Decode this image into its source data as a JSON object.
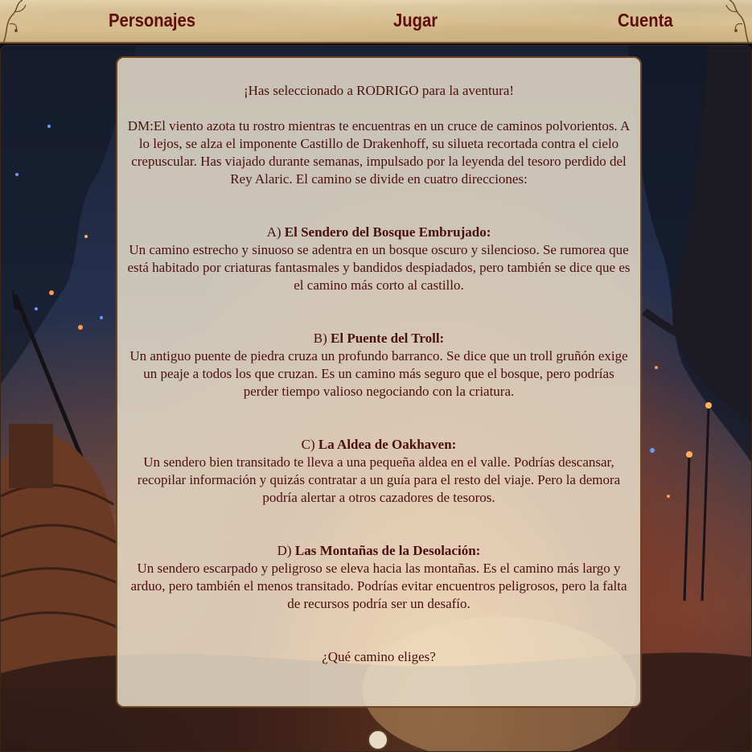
{
  "nav": {
    "items": [
      {
        "label": "Personajes"
      },
      {
        "label": "Jugar"
      },
      {
        "label": "Cuenta"
      }
    ]
  },
  "story": {
    "selected": "¡Has seleccionado a RODRIGO para la aventura!",
    "intro": "DM:El viento azota tu rostro mientras te encuentras en un cruce de caminos polvorientos. A lo lejos, se alza el imponente Castillo de Drakenhoff, su silueta recortada contra el cielo crepuscular. Has viajado durante semanas, impulsado por la leyenda del tesoro perdido del Rey Alaric. El camino se divide en cuatro direcciones:",
    "options": [
      {
        "letter": "A)",
        "title": "El Sendero del Bosque Embrujado:",
        "description": "Un camino estrecho y sinuoso se adentra en un bosque oscuro y silencioso. Se rumorea que está habitado por criaturas fantasmales y bandidos despiadados, pero también se dice que es el camino más corto al castillo."
      },
      {
        "letter": "B)",
        "title": "El Puente del Troll:",
        "description": "Un antiguo puente de piedra cruza un profundo barranco. Se dice que un troll gruñón exige un peaje a todos los que cruzan. Es un camino más seguro que el bosque, pero podrías perder tiempo valioso negociando con la criatura."
      },
      {
        "letter": "C)",
        "title": "La Aldea de Oakhaven:",
        "description": "Un sendero bien transitado te lleva a una pequeña aldea en el valle. Podrías descansar, recopilar información y quizás contratar a un guía para el resto del viaje. Pero la demora podría alertar a otros cazadores de tesoros."
      },
      {
        "letter": "D)",
        "title": "Las Montañas de la Desolación:",
        "description": "Un sendero escarpado y peligroso se eleva hacia las montañas. Es el camino más largo y arduo, pero también el menos transitado. Podrías evitar encuentros peligrosos, pero la falta de recursos podría ser un desafío."
      }
    ],
    "question": "¿Qué camino eliges?"
  },
  "colors": {
    "nav_text": "#5e0d0d",
    "story_text": "#4a0f0f",
    "card_border": "#6b4424"
  },
  "icons": {
    "corner_left": "vine-ornament-icon",
    "corner_right": "vine-ornament-icon",
    "scroll": "scroll-knob-icon"
  }
}
